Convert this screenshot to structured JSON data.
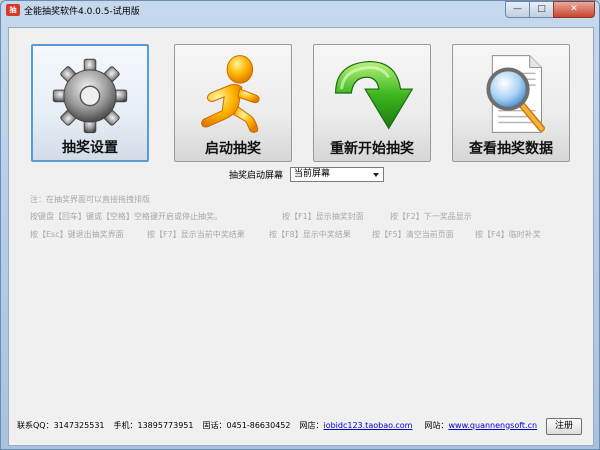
{
  "window": {
    "title": "全能抽奖软件4.0.0.5-试用版",
    "controls": {
      "minimize": "—",
      "maximize": "□",
      "close": "✕"
    }
  },
  "tiles": [
    {
      "label": "抽奖设置",
      "icon": "gear-icon",
      "selected": true
    },
    {
      "label": "启动抽奖",
      "icon": "running-man-icon",
      "selected": false
    },
    {
      "label": "重新开始抽奖",
      "icon": "curved-arrow-icon",
      "selected": false
    },
    {
      "label": "查看抽奖数据",
      "icon": "document-magnifier-icon",
      "selected": false
    }
  ],
  "screen": {
    "label": "抽奖启动屏幕",
    "selected": "当前屏幕"
  },
  "hints": {
    "line1": "注：在抽奖界面可以直接拖拽排版",
    "line2a": "按键盘【回车】键或【空格】空格键开启或停止抽奖。",
    "line2b": "按【F1】显示抽奖封面",
    "line2c": "按【F2】下一奖品显示",
    "line3a": "按【Esc】键退出抽奖界面",
    "line3b": "按【F7】显示当前中奖结果",
    "line3c": "按【F8】显示中奖结果",
    "line3d": "按【F5】清空当前页面",
    "line3e": "按【F4】临时补奖"
  },
  "footer": {
    "qq_label": "联系QQ：",
    "qq": "3147325531",
    "phone_label": "手机：",
    "phone": "13895773951",
    "tel_label": "固话：",
    "tel": "0451-86630452",
    "shop_label": "网店：",
    "shop": "iobidc123.taobao.com",
    "site_label": "网站：",
    "site": "www.quannengsoft.cn",
    "register": "注册"
  },
  "colors": {
    "accent": "#5b9bd5",
    "hint_text": "#a8a8a8",
    "link": "#0000cc"
  }
}
